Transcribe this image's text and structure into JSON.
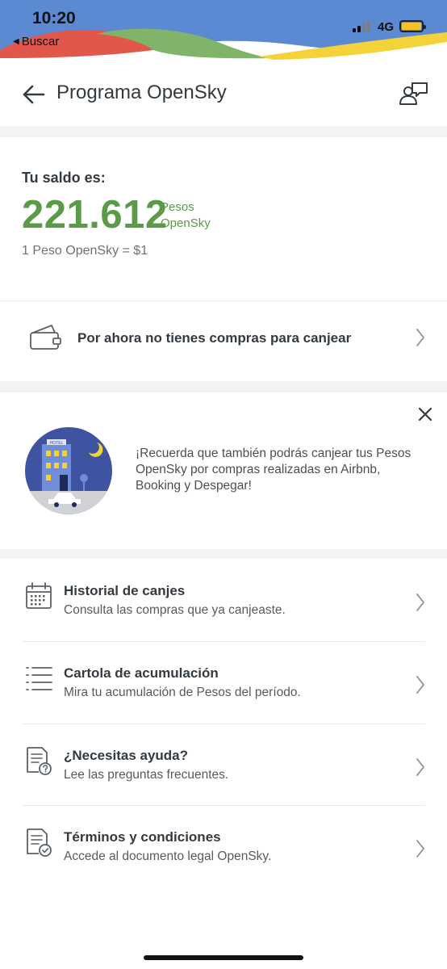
{
  "status_bar": {
    "time": "10:20",
    "back_app": "Buscar",
    "network": "4G",
    "colors": {
      "blue": "#5b8ad2",
      "red": "#e2574c",
      "green": "#7fb46a",
      "yellow": "#f3d23a"
    }
  },
  "header": {
    "title": "Programa OpenSky",
    "back_icon": "arrow-left-icon",
    "contact_icon": "person-chat-icon"
  },
  "balance": {
    "label": "Tu saldo es:",
    "amount": "221.612",
    "unit_line1": "Pesos",
    "unit_line2": "OpenSky",
    "rate": "1 Peso OpenSky = $1",
    "color": "#5a9a48"
  },
  "redeem": {
    "text": "Por ahora no tienes compras para canjear",
    "icon": "wallet-icon"
  },
  "promo": {
    "text": "¡Recuerda que también podrás canjear tus Pesos OpenSky por compras realizadas en Airbnb, Booking y Despegar!",
    "image_sign": "HOTEL"
  },
  "menu": [
    {
      "title": "Historial de canjes",
      "subtitle": "Consulta las compras que ya canjeaste.",
      "icon": "calendar-icon"
    },
    {
      "title": "Cartola de acumulación",
      "subtitle": "Mira tu acumulación de Pesos del período.",
      "icon": "list-icon"
    },
    {
      "title": "¿Necesitas ayuda?",
      "subtitle": "Lee las preguntas frecuentes.",
      "icon": "document-question-icon"
    },
    {
      "title": "Términos y condiciones",
      "subtitle": "Accede al documento legal OpenSky.",
      "icon": "document-check-icon"
    }
  ]
}
